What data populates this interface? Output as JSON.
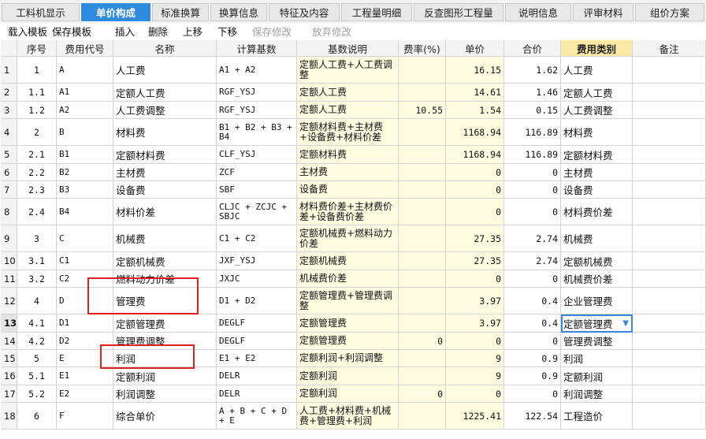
{
  "tabs": [
    {
      "label": "工料机显示",
      "active": false
    },
    {
      "label": "单价构成",
      "active": true
    },
    {
      "label": "标准换算",
      "active": false
    },
    {
      "label": "换算信息",
      "active": false
    },
    {
      "label": "特征及内容",
      "active": false
    },
    {
      "label": "工程量明细",
      "active": false
    },
    {
      "label": "反查图形工程量",
      "active": false
    },
    {
      "label": "说明信息",
      "active": false
    },
    {
      "label": "评审材料",
      "active": false
    },
    {
      "label": "组价方案",
      "active": false
    }
  ],
  "toolbar": {
    "load_template": "载入模板",
    "save_template": "保存模板",
    "insert": "插入",
    "delete": "删除",
    "move_up": "上移",
    "move_down": "下移",
    "save_changes": "保存修改",
    "discard_changes": "放弃修改"
  },
  "columns": [
    "",
    "序号",
    "费用代号",
    "名称",
    "计算基数",
    "基数说明",
    "费率(%)",
    "单价",
    "合价",
    "费用类别",
    "备注"
  ],
  "rows": [
    {
      "rn": "1",
      "seq": "1",
      "code": "A",
      "name": "人工费",
      "base": "A1 + A2",
      "desc": "定额人工费+人工费调整",
      "rate": "",
      "price": "16.15",
      "total": "1.62",
      "cat": "人工费",
      "note": ""
    },
    {
      "rn": "2",
      "seq": "1.1",
      "code": "A1",
      "name": "定额人工费",
      "base": "RGF_YSJ",
      "desc": "定额人工费",
      "rate": "",
      "price": "14.61",
      "total": "1.46",
      "cat": "定额人工费",
      "note": ""
    },
    {
      "rn": "3",
      "seq": "1.2",
      "code": "A2",
      "name": "人工费调整",
      "base": "RGF_YSJ",
      "desc": "定额人工费",
      "rate": "10.55",
      "price": "1.54",
      "total": "0.15",
      "cat": "人工费调整",
      "note": ""
    },
    {
      "rn": "4",
      "seq": "2",
      "code": "B",
      "name": "材料费",
      "base": "B1 + B2 + B3 + B4",
      "desc": "定额材料费+主材费+设备费+材料价差",
      "rate": "",
      "price": "1168.94",
      "total": "116.89",
      "cat": "材料费",
      "note": ""
    },
    {
      "rn": "5",
      "seq": "2.1",
      "code": "B1",
      "name": "定额材料费",
      "base": "CLF_YSJ",
      "desc": "定额材料费",
      "rate": "",
      "price": "1168.94",
      "total": "116.89",
      "cat": "定额材料费",
      "note": ""
    },
    {
      "rn": "6",
      "seq": "2.2",
      "code": "B2",
      "name": "主材费",
      "base": "ZCF",
      "desc": "主材费",
      "rate": "",
      "price": "0",
      "total": "0",
      "cat": "主材费",
      "note": ""
    },
    {
      "rn": "7",
      "seq": "2.3",
      "code": "B3",
      "name": "设备费",
      "base": "SBF",
      "desc": "设备费",
      "rate": "",
      "price": "0",
      "total": "0",
      "cat": "设备费",
      "note": ""
    },
    {
      "rn": "8",
      "seq": "2.4",
      "code": "B4",
      "name": "材料价差",
      "base": "CLJC + ZCJC + SBJC",
      "desc": "材料费价差+主材费价差+设备费价差",
      "rate": "",
      "price": "0",
      "total": "0",
      "cat": "材料费价差",
      "note": ""
    },
    {
      "rn": "9",
      "seq": "3",
      "code": "C",
      "name": "机械费",
      "base": "C1 + C2",
      "desc": "定额机械费+燃料动力价差",
      "rate": "",
      "price": "27.35",
      "total": "2.74",
      "cat": "机械费",
      "note": ""
    },
    {
      "rn": "10",
      "seq": "3.1",
      "code": "C1",
      "name": "定额机械费",
      "base": "JXF_YSJ",
      "desc": "定额机械费",
      "rate": "",
      "price": "27.35",
      "total": "2.74",
      "cat": "定额机械费",
      "note": ""
    },
    {
      "rn": "11",
      "seq": "3.2",
      "code": "C2",
      "name": "燃料动力价差",
      "base": "JXJC",
      "desc": "机械费价差",
      "rate": "",
      "price": "0",
      "total": "0",
      "cat": "机械费价差",
      "note": ""
    },
    {
      "rn": "12",
      "seq": "4",
      "code": "D",
      "name": "管理费",
      "base": "D1 + D2",
      "desc": "定额管理费+管理费调整",
      "rate": "",
      "price": "3.97",
      "total": "0.4",
      "cat": "企业管理费",
      "note": ""
    },
    {
      "rn": "13",
      "seq": "4.1",
      "code": "D1",
      "name": "定额管理费",
      "base": "DEGLF",
      "desc": "定额管理费",
      "rate": "",
      "price": "3.97",
      "total": "0.4",
      "cat": "定额管理费",
      "note": ""
    },
    {
      "rn": "14",
      "seq": "4.2",
      "code": "D2",
      "name": "管理费调整",
      "base": "DEGLF",
      "desc": "定额管理费",
      "rate": "0",
      "price": "0",
      "total": "0",
      "cat": "管理费调整",
      "note": ""
    },
    {
      "rn": "15",
      "seq": "5",
      "code": "E",
      "name": "利润",
      "base": "E1 + E2",
      "desc": "定额利润+利润调整",
      "rate": "",
      "price": "9",
      "total": "0.9",
      "cat": "利润",
      "note": ""
    },
    {
      "rn": "16",
      "seq": "5.1",
      "code": "E1",
      "name": "定额利润",
      "base": "DELR",
      "desc": "定额利润",
      "rate": "",
      "price": "9",
      "total": "0.9",
      "cat": "定额利润",
      "note": ""
    },
    {
      "rn": "17",
      "seq": "5.2",
      "code": "E2",
      "name": "利润调整",
      "base": "DELR",
      "desc": "定额利润",
      "rate": "0",
      "price": "0",
      "total": "0",
      "cat": "利润调整",
      "note": ""
    },
    {
      "rn": "18",
      "seq": "6",
      "code": "F",
      "name": "综合单价",
      "base": "A + B + C + D + E",
      "desc": "人工费+材料费+机械费+管理费+利润",
      "rate": "",
      "price": "1225.41",
      "total": "122.54",
      "cat": "工程造价",
      "note": ""
    }
  ],
  "selected_row": "13",
  "dropdown_icon": "chevron-down-icon"
}
